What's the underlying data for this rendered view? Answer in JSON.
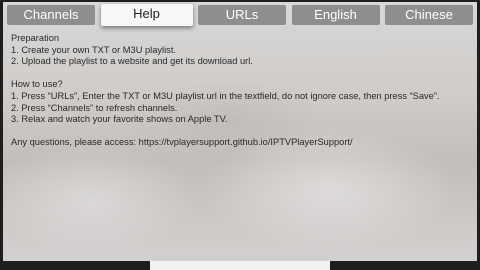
{
  "tabs": [
    {
      "label": "Channels",
      "active": false
    },
    {
      "label": "Help",
      "active": true
    },
    {
      "label": "URLs",
      "active": false
    },
    {
      "label": "English",
      "active": false
    },
    {
      "label": "Chinese",
      "active": false
    }
  ],
  "help": {
    "preparation_heading": "Preparation",
    "preparation_steps": [
      "1. Create your own TXT or M3U playlist.",
      "2. Upload the playlist to a website and get its download url."
    ],
    "usage_heading": "How to use?",
    "usage_steps": [
      "1. Press “URLs”, Enter the TXT or M3U playlist url in the textfield, do not ignore case, then press “Save”.",
      "2. Press “Channels” to refresh channels.",
      "3. Relax and watch your favorite shows on Apple TV."
    ],
    "support_line": "Any questions, please access: https://tvplayersupport.github.io/IPTVPlayerSupport/"
  },
  "colors": {
    "tab_inactive": "#8f8d8d",
    "tab_active": "#f7f7f7",
    "bezel": "#1e1e1e"
  }
}
